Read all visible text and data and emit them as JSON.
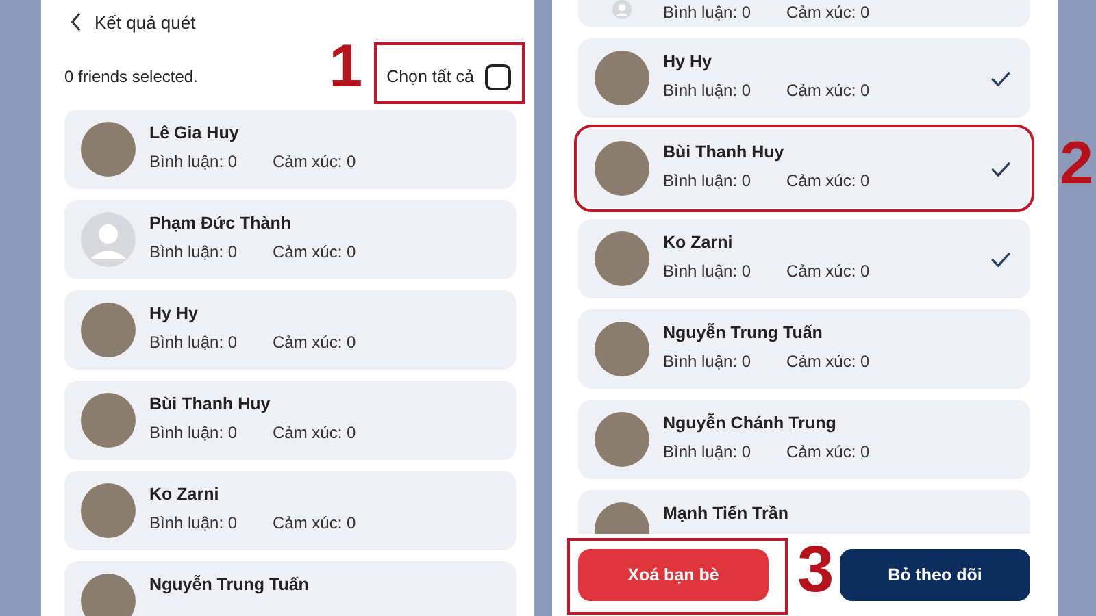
{
  "panels": [
    {
      "header": {
        "title": "Kết quả quét"
      },
      "selection": {
        "count_text": "0 friends selected.",
        "select_all_label": "Chọn tất cả",
        "select_all_checked": false,
        "annotation": "1"
      },
      "friends": [
        {
          "name": "Lê Gia Huy",
          "comments": "Bình luận: 0",
          "reactions": "Cảm xúc: 0",
          "kind": "photo",
          "selected": false
        },
        {
          "name": "Phạm Đức Thành",
          "comments": "Bình luận: 0",
          "reactions": "Cảm xúc: 0",
          "kind": "default",
          "selected": false
        },
        {
          "name": "Hy Hy",
          "comments": "Bình luận: 0",
          "reactions": "Cảm xúc: 0",
          "kind": "photo",
          "selected": false
        },
        {
          "name": "Bùi Thanh Huy",
          "comments": "Bình luận: 0",
          "reactions": "Cảm xúc: 0",
          "kind": "photo",
          "selected": false
        },
        {
          "name": "Ko Zarni",
          "comments": "Bình luận: 0",
          "reactions": "Cảm xúc: 0",
          "kind": "photo",
          "selected": false
        },
        {
          "name": "Nguyễn Trung Tuấn",
          "kind": "photo",
          "selected": false
        }
      ]
    },
    {
      "friends": [
        {
          "comments": "Bình luận: 0",
          "reactions": "Cảm xúc: 0",
          "kind": "default",
          "selected": false
        },
        {
          "name": "Hy Hy",
          "comments": "Bình luận: 0",
          "reactions": "Cảm xúc: 0",
          "kind": "photo",
          "selected": true
        },
        {
          "name": "Bùi Thanh Huy",
          "comments": "Bình luận: 0",
          "reactions": "Cảm xúc: 0",
          "kind": "photo",
          "selected": true,
          "annotation": "2"
        },
        {
          "name": "Ko Zarni",
          "comments": "Bình luận: 0",
          "reactions": "Cảm xúc: 0",
          "kind": "photo",
          "selected": true
        },
        {
          "name": "Nguyễn Trung Tuấn",
          "comments": "Bình luận: 0",
          "reactions": "Cảm xúc: 0",
          "kind": "photo",
          "selected": false
        },
        {
          "name": "Nguyễn Chánh Trung",
          "comments": "Bình luận: 0",
          "reactions": "Cảm xúc: 0",
          "kind": "photo",
          "selected": false
        },
        {
          "name": "Mạnh Tiến Trần",
          "kind": "photo",
          "selected": false
        }
      ],
      "actions": [
        {
          "label": "Xoá bạn bè",
          "kind": "danger",
          "annotation": "3"
        },
        {
          "label": "Bỏ theo dõi",
          "kind": "primary"
        }
      ]
    }
  ]
}
